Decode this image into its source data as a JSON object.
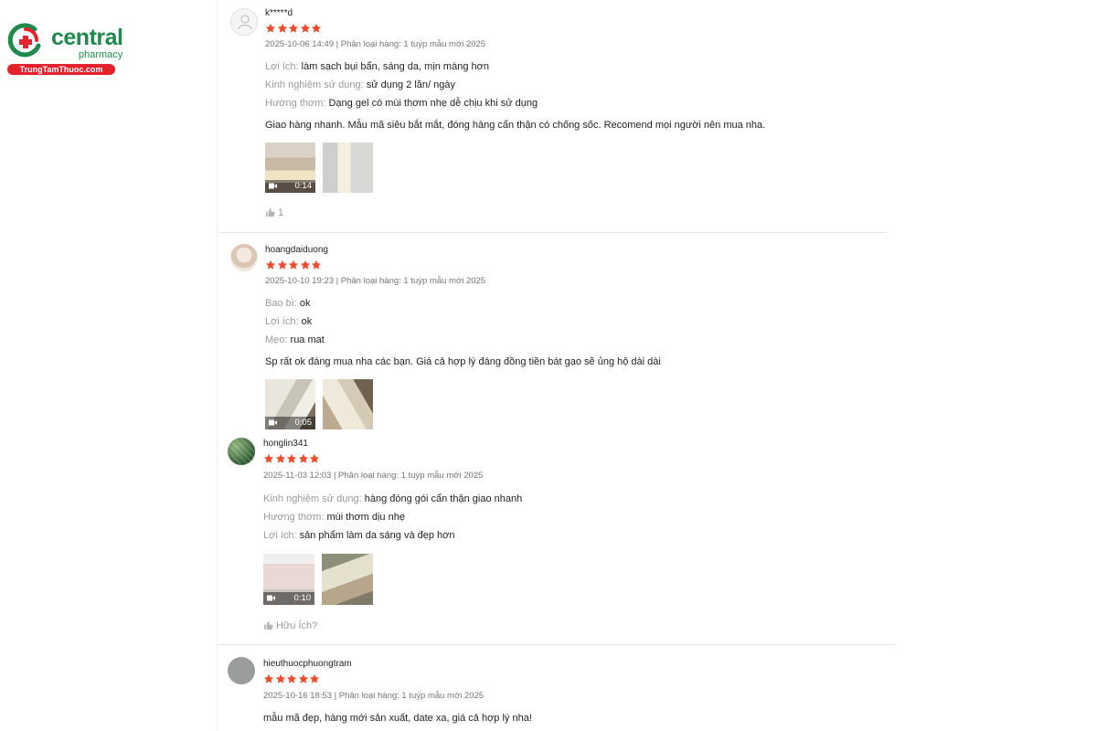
{
  "brand": {
    "name": "central",
    "sub": "pharmacy",
    "site": "TrungTamThuoc.com"
  },
  "colors": {
    "brand_green": "#1f8a4c",
    "brand_red": "#e4222b",
    "star": "#ee4d2d"
  },
  "reviews": [
    {
      "username": "k*****d",
      "rating": 5,
      "meta": "2025-10-06 14:49 | Phân loại hàng: 1 tuýp mẫu mới 2025",
      "fields": [
        {
          "key": "Lợi ích:",
          "value": "làm sạch bụi bẩn, sáng da, mịn màng hơn"
        },
        {
          "key": "Kinh nghiệm sử dụng:",
          "value": "sử dụng 2 lần/ ngày"
        },
        {
          "key": "Hương thơm:",
          "value": "Dạng gel có mùi thơm nhẹ dễ chịu khi sử dụng"
        }
      ],
      "comment": "Giao hàng nhanh. Mẫu mã siêu bắt mắt, đóng hàng cẩn thận có chống sốc. Recomend mọi người nên mua nha.",
      "video_duration": "0:14",
      "likes": "1"
    },
    {
      "username": "hoangdaiduong",
      "rating": 5,
      "meta": "2025-10-10 19:23 | Phân loại hàng: 1 tuýp mẫu mới 2025",
      "fields": [
        {
          "key": "Bao bì:",
          "value": "ok"
        },
        {
          "key": "Lợi ích:",
          "value": "ok"
        },
        {
          "key": "Mẹo:",
          "value": "rua mat"
        }
      ],
      "comment": "Sp rất ok đáng mua nha các bạn. Giá cả hợp lý đáng đồng tiền bát gạo sẽ ủng hộ dài dài",
      "video_duration": "0:05"
    },
    {
      "username": "honglin341",
      "rating": 5,
      "meta": "2025-11-03 12:03 | Phân loại hàng: 1 tuýp mẫu mới 2025",
      "fields": [
        {
          "key": "Kinh nghiệm sử dụng:",
          "value": "hàng đóng gói cẩn thận giao nhanh"
        },
        {
          "key": "Hương thơm:",
          "value": "mùi thơm dịu nhẹ"
        },
        {
          "key": "Lợi ích:",
          "value": "sản phẩm làm da sáng và đẹp hơn"
        }
      ],
      "video_duration": "0:10",
      "helpful_label": "Hữu Ích?"
    },
    {
      "username": "hieuthuocphuongtram",
      "rating": 5,
      "meta": "2025-10-16 18:53 | Phân loại hàng: 1 tuýp mẫu mới 2025",
      "comment": "mẫu mã đẹp, hàng mới sản xuất, date xa, giá cả hợp lý nha!"
    }
  ]
}
